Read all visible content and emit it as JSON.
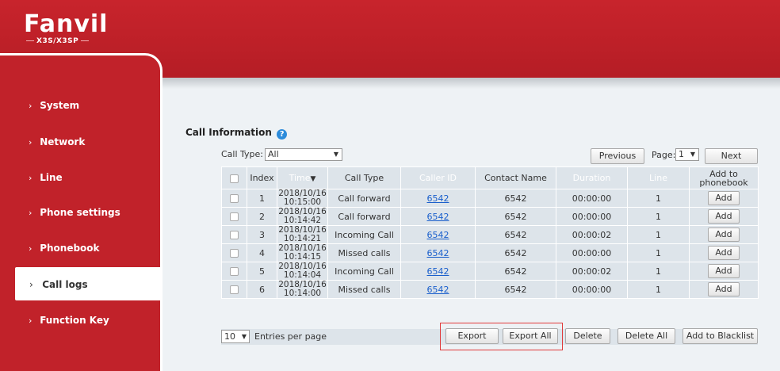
{
  "brand": {
    "logo_text": "Fanvil",
    "model": "X3S/X3SP"
  },
  "sidebar": {
    "items": [
      {
        "label": "System"
      },
      {
        "label": "Network"
      },
      {
        "label": "Line"
      },
      {
        "label": "Phone settings"
      },
      {
        "label": "Phonebook"
      },
      {
        "label": "Call logs",
        "active": true
      },
      {
        "label": "Function Key"
      }
    ]
  },
  "section": {
    "title": "Call Information",
    "help_icon": "question-circle-icon"
  },
  "filters": {
    "call_type_label": "Call Type:",
    "call_type_value": "All",
    "previous_label": "Previous",
    "page_label": "Page:",
    "page_value": "1",
    "next_label": "Next"
  },
  "table": {
    "headers": {
      "index": "Index",
      "time": "Time",
      "call_type": "Call Type",
      "caller_id": "Caller ID",
      "contact_name": "Contact Name",
      "duration": "Duration",
      "line": "Line",
      "add_to_phonebook": "Add to phonebook"
    },
    "sort_icon": "sort-desc-icon",
    "rows": [
      {
        "index": "1",
        "date": "2018/10/16",
        "time": "10:15:00",
        "call_type": "Call forward",
        "caller_id": "6542",
        "contact_name": "6542",
        "duration": "00:00:00",
        "line": "1",
        "add_label": "Add"
      },
      {
        "index": "2",
        "date": "2018/10/16",
        "time": "10:14:42",
        "call_type": "Call forward",
        "caller_id": "6542",
        "contact_name": "6542",
        "duration": "00:00:00",
        "line": "1",
        "add_label": "Add"
      },
      {
        "index": "3",
        "date": "2018/10/16",
        "time": "10:14:21",
        "call_type": "Incoming Call",
        "caller_id": "6542",
        "contact_name": "6542",
        "duration": "00:00:02",
        "line": "1",
        "add_label": "Add"
      },
      {
        "index": "4",
        "date": "2018/10/16",
        "time": "10:14:15",
        "call_type": "Missed calls",
        "caller_id": "6542",
        "contact_name": "6542",
        "duration": "00:00:00",
        "line": "1",
        "add_label": "Add"
      },
      {
        "index": "5",
        "date": "2018/10/16",
        "time": "10:14:04",
        "call_type": "Incoming Call",
        "caller_id": "6542",
        "contact_name": "6542",
        "duration": "00:00:02",
        "line": "1",
        "add_label": "Add"
      },
      {
        "index": "6",
        "date": "2018/10/16",
        "time": "10:14:00",
        "call_type": "Missed calls",
        "caller_id": "6542",
        "contact_name": "6542",
        "duration": "00:00:00",
        "line": "1",
        "add_label": "Add"
      }
    ]
  },
  "footer": {
    "per_page_value": "10",
    "per_page_label": "Entries per page",
    "export_label": "Export",
    "export_all_label": "Export All",
    "delete_label": "Delete",
    "delete_all_label": "Delete All",
    "blacklist_label": "Add to Blacklist"
  },
  "colors": {
    "brand_red": "#c1222a",
    "content_bg": "#eef2f5",
    "table_bg": "#dde4ea",
    "link": "#1a5fcc",
    "highlight": "#e03a3a"
  }
}
